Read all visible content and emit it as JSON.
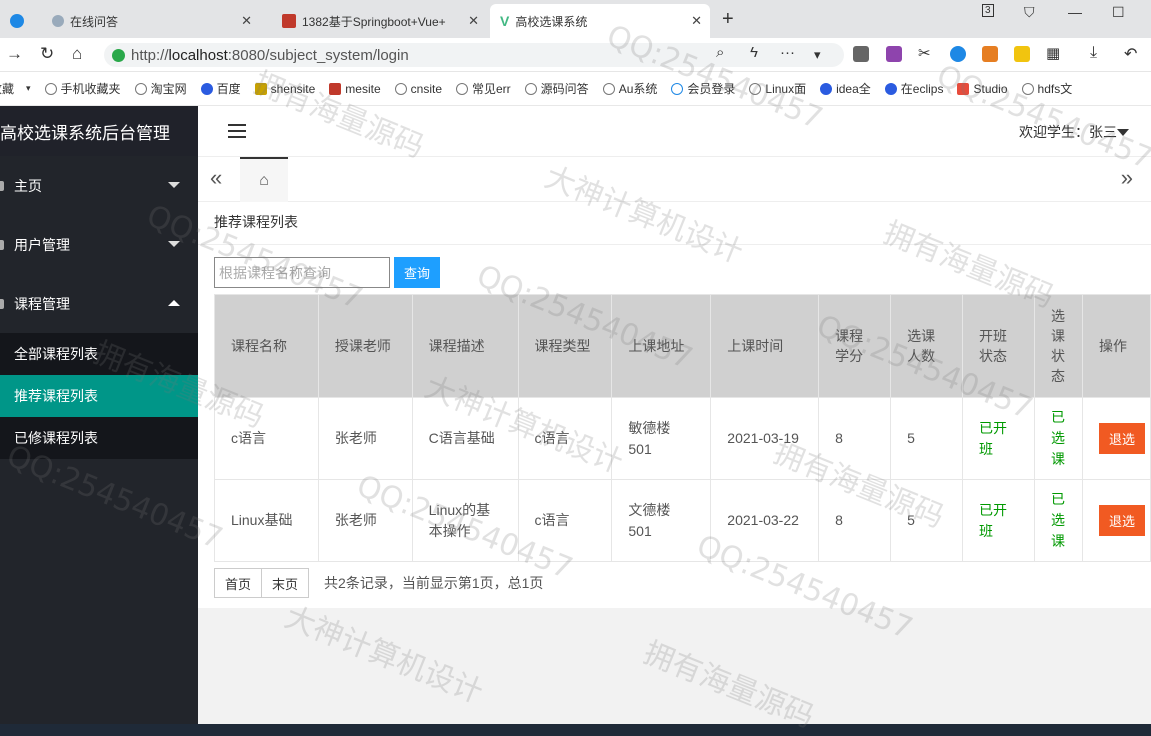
{
  "browser": {
    "tabs": [
      {
        "title": "在线问答"
      },
      {
        "title": "1382基于Springboot+Vue+"
      },
      {
        "title": "高校选课系统"
      }
    ],
    "url_prefix": "http://",
    "url_host": "localhost",
    "url_rest": ":8080/subject_system/login",
    "bookmarks": [
      "收藏",
      "手机收藏夹",
      "淘宝网",
      "百度",
      "shensite",
      "mesite",
      "cnsite",
      "常见err",
      "源码问答",
      "Au系统",
      "会员登录",
      "Linux面",
      "idea全",
      "在eclips",
      "Studio",
      "hdfs文"
    ]
  },
  "sidebar": {
    "title": "高校选课系统后台管理",
    "menus": [
      {
        "label": "主页"
      },
      {
        "label": "用户管理"
      },
      {
        "label": "课程管理"
      }
    ],
    "submenu": [
      {
        "label": "全部课程列表"
      },
      {
        "label": "推荐课程列表"
      },
      {
        "label": "已修课程列表"
      }
    ]
  },
  "header": {
    "welcome": "欢迎学生：张三"
  },
  "page": {
    "breadcrumb": "推荐课程列表",
    "search_placeholder": "根据课程名称查询",
    "search_button": "查询"
  },
  "table": {
    "headers": [
      "课程名称",
      "授课老师",
      "课程描述",
      "课程类型",
      "上课地址",
      "上课时间",
      "课程学分",
      "选课人数",
      "开班状态",
      "选课状态",
      "操作"
    ],
    "rows": [
      {
        "name": "c语言",
        "teacher": "张老师",
        "desc": "C语言基础",
        "type": "c语言",
        "addr": "敏德楼501",
        "time": "2021-03-19",
        "credit": "8",
        "count": "5",
        "open": "已开班",
        "status": "已选课",
        "action": "退选"
      },
      {
        "name": "Linux基础",
        "teacher": "张老师",
        "desc": "Linux的基本操作",
        "type": "c语言",
        "addr": "文德楼501",
        "time": "2021-03-22",
        "credit": "8",
        "count": "5",
        "open": "已开班",
        "status": "已选课",
        "action": "退选"
      }
    ]
  },
  "pager": {
    "first": "首页",
    "last": "末页",
    "info": "共2条记录，当前显示第1页，总1页"
  },
  "watermarks": [
    "QQ:254540457",
    "大神计算机设计",
    "拥有海量源码"
  ],
  "colors": {
    "sidebar_bg": "#22252b",
    "active_item": "#009688",
    "search_btn": "#1e9fff",
    "drop_btn": "#f15a22",
    "status_green": "#009900"
  }
}
